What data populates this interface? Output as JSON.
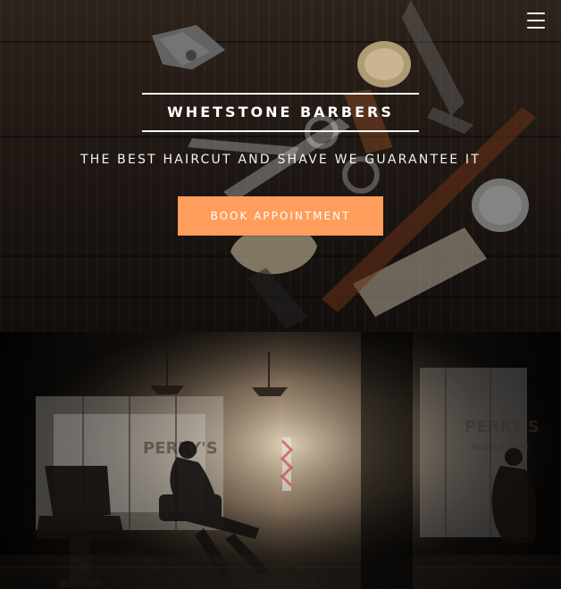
{
  "header": {
    "menu_icon": "hamburger-menu-icon"
  },
  "hero": {
    "brand": "WHETSTONE BARBERS",
    "tagline": "THE BEST HAIRCUT AND SHAVE WE GUARANTEE IT",
    "cta_label": "BOOK APPOINTMENT"
  },
  "interior": {
    "left_window_sign": "PERRY'S",
    "right_window_sign": "PERRY'S",
    "right_window_subsign": "BARBER SHOP"
  },
  "colors": {
    "accent": "#ff9d5c",
    "text": "#ffffff",
    "hero_bg": "#2b211b",
    "interior_bg": "#0b0a08"
  }
}
